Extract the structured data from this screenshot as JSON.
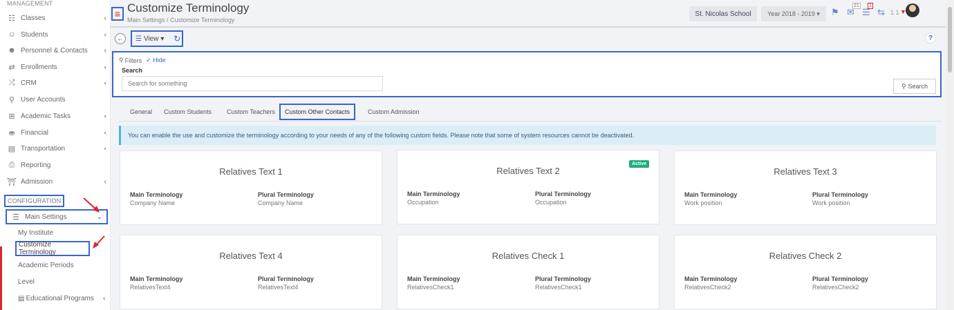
{
  "sidebar": {
    "management_title": "MANAGEMENT",
    "items": [
      {
        "label": "Classes",
        "icon": "classes-icon"
      },
      {
        "label": "Students",
        "icon": "students-icon"
      },
      {
        "label": "Personnel & Contacts",
        "icon": "personnel-icon"
      },
      {
        "label": "Enrollments",
        "icon": "enrollments-icon"
      },
      {
        "label": "CRM",
        "icon": "crm-icon"
      },
      {
        "label": "User Accounts",
        "icon": "key-icon"
      },
      {
        "label": "Academic Tasks",
        "icon": "grid-icon"
      },
      {
        "label": "Financial",
        "icon": "financial-icon"
      },
      {
        "label": "Transportation",
        "icon": "bus-icon"
      },
      {
        "label": "Reporting",
        "icon": "printer-icon"
      },
      {
        "label": "Admission",
        "icon": "building-icon"
      }
    ],
    "config_title": "CONFIGURATION",
    "main_settings": "Main Settings",
    "sub_items": [
      "My Institute",
      "Customize Terminology",
      "Academic Periods",
      "Level",
      "Educational Programs"
    ]
  },
  "header": {
    "title": "Customize Terminology",
    "breadcrumb": "Main Settings  /  Customize Terminology",
    "school": "St. Nicolas School",
    "year": "Year 2018 - 2019 ▾",
    "badge_messages": "21",
    "badge_alerts": "1",
    "user_count": "1 1"
  },
  "toolbar": {
    "view_label": "View ▾",
    "help_label": "?"
  },
  "filters": {
    "title": "Filters",
    "hide_label": "Hide",
    "search_label": "Search",
    "search_placeholder": "Search for something",
    "search_button": "Search"
  },
  "tabs": [
    "General",
    "Custom Students",
    "Custom Teachers",
    "Custom Other Contacts",
    "Custom Admission"
  ],
  "info_text": "You can enable the use and customize the terminology according to your needs of any of the following custom fields. Please note that some of system resources cannot be deactivated.",
  "cards": [
    {
      "title": "Relatives Text 1",
      "main_label": "Main Terminology",
      "main_value": "Company Name",
      "plural_label": "Plural Terminology",
      "plural_value": "Company Name",
      "badge": ""
    },
    {
      "title": "Relatives Text 2",
      "main_label": "Main Terminology",
      "main_value": "Occupation",
      "plural_label": "Plural Terminology",
      "plural_value": "Occupation",
      "badge": "Active"
    },
    {
      "title": "Relatives Text 3",
      "main_label": "Main Terminology",
      "main_value": "Work position",
      "plural_label": "Plural Terminology",
      "plural_value": "Work position",
      "badge": ""
    },
    {
      "title": "Relatives Text 4",
      "main_label": "Main Terminology",
      "main_value": "RelativesText4",
      "plural_label": "Plural Terminology",
      "plural_value": "RelativesText4",
      "badge": ""
    },
    {
      "title": "Relatives Check 1",
      "main_label": "Main Terminology",
      "main_value": "RelativesCheck1",
      "plural_label": "Plural Terminology",
      "plural_value": "RelativesCheck1",
      "badge": ""
    },
    {
      "title": "Relatives Check 2",
      "main_label": "Main Terminology",
      "main_value": "RelativesCheck2",
      "plural_label": "Plural Terminology",
      "plural_value": "RelativesCheck2",
      "badge": ""
    }
  ],
  "colors": {
    "accent": "#3a66c8",
    "danger": "#d9272e",
    "active": "#1fad7e",
    "info_bg": "#dbeef7"
  }
}
